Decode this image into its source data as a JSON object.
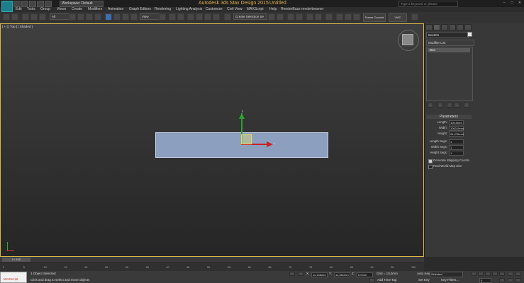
{
  "window": {
    "title": "Autodesk 3ds Max Design 2015",
    "document": "Untitled",
    "workspace": "Workspace: Default",
    "search_placeholder": "Type a keyword or phrase"
  },
  "menu": [
    "Edit",
    "Tools",
    "Group",
    "Views",
    "Create",
    "Modifiers",
    "Animation",
    "Graph Editors",
    "Rendering",
    "Lighting Analysis",
    "Customize",
    "Civil View",
    "MAXScript",
    "Help",
    "RenderBuzz",
    "renderbeamer"
  ],
  "toolbar": {
    "selection_filter": "All",
    "reference_coord": "View",
    "named_selection": "Create Selection Se",
    "ribbon_label": "Frame Convert",
    "ribbon_label2": "VMC"
  },
  "viewport": {
    "label": "[ + ] [ Top ] [ Shaded ]",
    "axis_y": "y",
    "axis_x": "x"
  },
  "command_panel": {
    "object_name": "Box001",
    "object_color": "#e6e6e6",
    "modifier_list": "Modifier List",
    "stack_item": "Box",
    "parameters_header": "Parameters",
    "params": [
      {
        "label": "Length:",
        "value": "100,0mm"
      },
      {
        "label": "Width:",
        "value": "1000,0mm"
      },
      {
        "label": "Height:",
        "value": "24,476mm"
      }
    ],
    "segs": [
      {
        "label": "Length Segs:",
        "value": "1"
      },
      {
        "label": "Width Segs:",
        "value": "1"
      },
      {
        "label": "Height Segs:",
        "value": "1"
      }
    ],
    "checks": [
      {
        "label": "Generate Mapping Coords.",
        "checked": true
      },
      {
        "label": "Real-World Map Size",
        "checked": false
      }
    ]
  },
  "timeline": {
    "slider": "0 / 100",
    "ticks": [
      "0",
      "5",
      "10",
      "15",
      "20",
      "25",
      "30",
      "35",
      "40",
      "45",
      "50",
      "55",
      "60",
      "65",
      "70",
      "75",
      "80",
      "85",
      "90",
      "95",
      "100"
    ]
  },
  "status": {
    "maxscript": "MAXScript",
    "selection": "1 Object Selected",
    "prompt": "Click and drag to select and move objects",
    "x": "11,146mm",
    "y": "11,361mm",
    "z": "0,0mm",
    "grid": "Grid = 10,0mm",
    "add_time_tag": "Add Time Tag",
    "auto_key": "Auto Key",
    "set_key": "Set Key",
    "key_filters": "Key Filters...",
    "selected": "Selected",
    "frame": "0"
  }
}
